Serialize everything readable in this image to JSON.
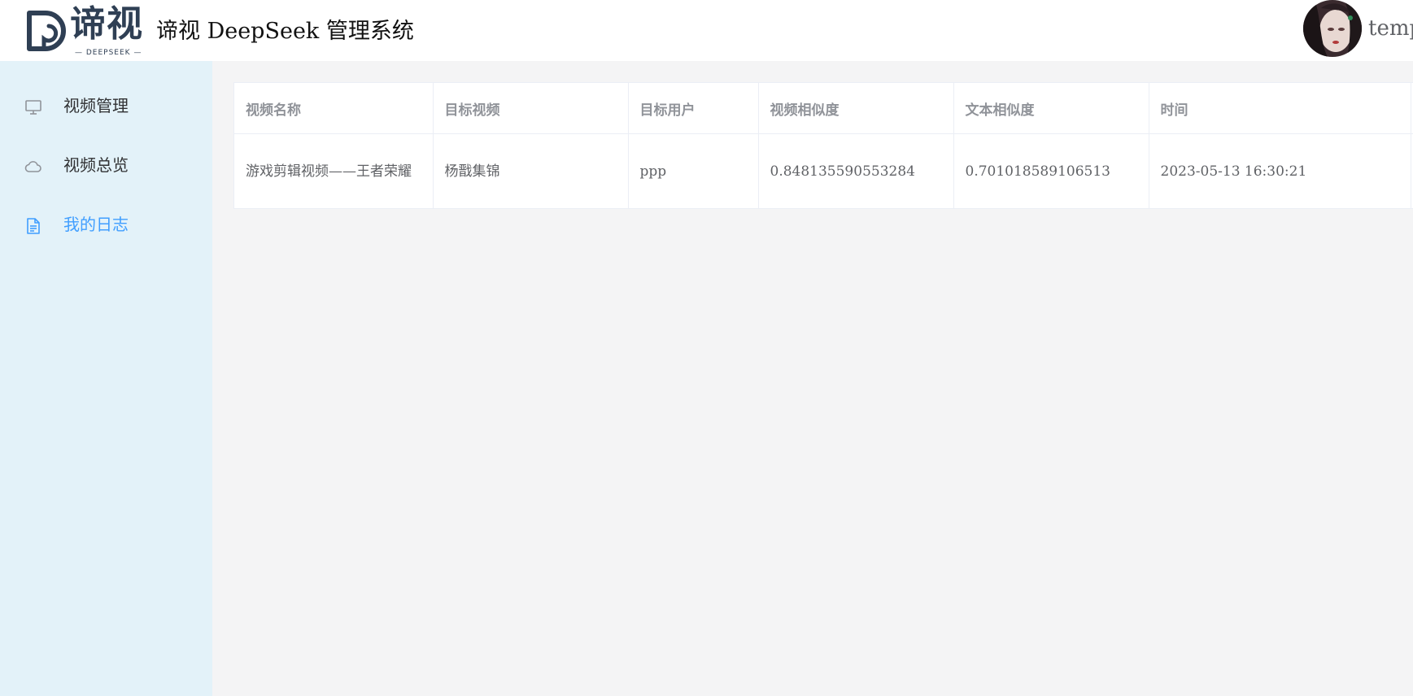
{
  "header": {
    "logo_text": "谛视",
    "logo_subtext": "— DEEPSEEK —",
    "app_title": "谛视 DeepSeek 管理系统",
    "username": "temp"
  },
  "sidebar": {
    "items": [
      {
        "label": "视频管理",
        "icon": "monitor-icon",
        "active": false
      },
      {
        "label": "视频总览",
        "icon": "cloud-icon",
        "active": false
      },
      {
        "label": "我的日志",
        "icon": "document-icon",
        "active": true
      }
    ]
  },
  "table": {
    "columns": [
      "视频名称",
      "目标视频",
      "目标用户",
      "视频相似度",
      "文本相似度",
      "时间",
      ""
    ],
    "rows": [
      {
        "video_name": "游戏剪辑视频——王者荣耀",
        "target_video": "杨戬集锦",
        "target_user": "ppp",
        "video_similarity": "0.848135590553284",
        "text_similarity": "0.701018589106513",
        "time": "2023-05-13 16:30:21",
        "extra": ""
      }
    ]
  },
  "colors": {
    "active": "#409eff",
    "sidebar_bg": "#e3f2f9",
    "logo": "#2f3f54"
  }
}
